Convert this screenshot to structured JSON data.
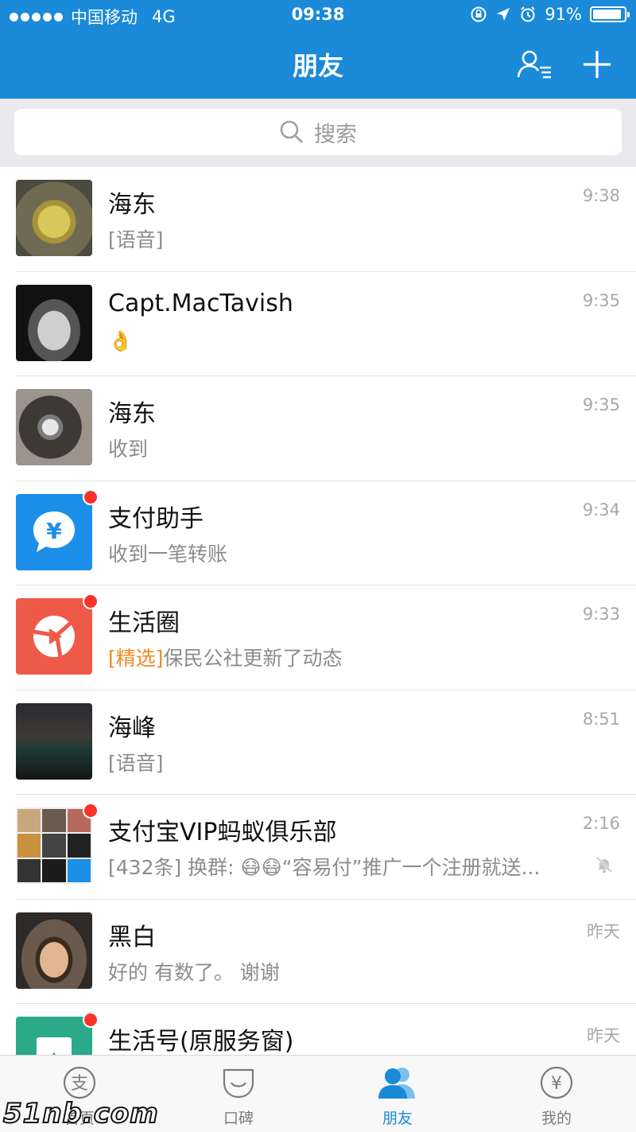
{
  "status_bar": {
    "carrier": "中国移动",
    "network": "4G",
    "time": "09:38",
    "battery": "91%",
    "battery_level": 0.91
  },
  "header": {
    "title": "朋友",
    "contacts_icon": "contacts-list-icon",
    "add_icon": "plus-icon",
    "bg_color": "#1a8ad9"
  },
  "search": {
    "placeholder": "搜索"
  },
  "conversations": [
    {
      "name": "海东",
      "preview": "[语音]",
      "time": "9:38",
      "unread": false
    },
    {
      "name": "Capt.MacTavish",
      "preview": "👌",
      "time": "9:35",
      "unread": false
    },
    {
      "name": "海东",
      "preview": "收到",
      "time": "9:35",
      "unread": false
    },
    {
      "name": "支付助手",
      "preview": "收到一笔转账",
      "time": "9:34",
      "unread": true
    },
    {
      "name": "生活圈",
      "preview_tag": "[精选]",
      "preview": "保民公社更新了动态",
      "time": "9:33",
      "unread": true
    },
    {
      "name": "海峰",
      "preview": "[语音]",
      "time": "8:51",
      "unread": false
    },
    {
      "name": "支付宝VIP蚂蚁俱乐部",
      "preview": "[432条] 换群: 😷😷“容易付”推广一个注册就送...",
      "time": "2:16",
      "unread": true,
      "muted": true
    },
    {
      "name": "黑白",
      "preview": "好的 有数了。 谢谢",
      "time": "昨天",
      "unread": false
    },
    {
      "name": "生活号(原服务窗)",
      "preview": "",
      "time": "昨天",
      "unread": true
    }
  ],
  "tabbar": {
    "tabs": [
      {
        "label": "首页",
        "icon": "alipay-home-icon"
      },
      {
        "label": "口碑",
        "icon": "koubei-icon"
      },
      {
        "label": "朋友",
        "icon": "friends-icon",
        "active": true
      },
      {
        "label": "我的",
        "icon": "wallet-icon"
      }
    ],
    "active_color": "#1a8ad9"
  },
  "watermark": "51nb.com"
}
